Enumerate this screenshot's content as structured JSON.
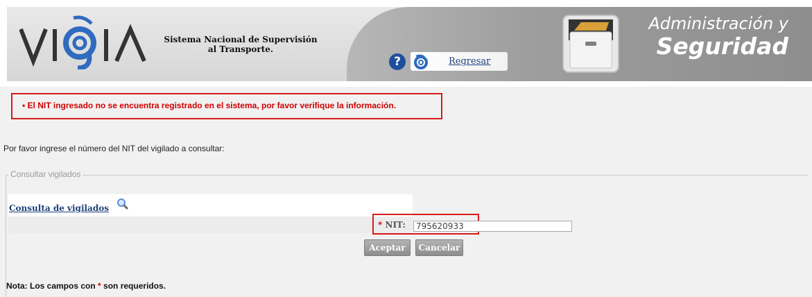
{
  "header": {
    "logo_text": "VIGIA",
    "tagline_line1": "Sistema Nacional de Supervisión",
    "tagline_line2": "al Transporte.",
    "help_symbol": "?",
    "back_link": "Regresar",
    "section_title_line1": "Administración y",
    "section_title_line2": "Seguridad",
    "icons": [
      "help-icon",
      "back-logo-icon",
      "file-cabinet-icon"
    ]
  },
  "error": {
    "bullet": "•",
    "message": "El NIT ingresado no se encuentra registrado en el sistema, por favor verifique la información."
  },
  "instruction": "Por favor ingrese el número del NIT del vigilado a consultar:",
  "fieldset": {
    "legend": "Consultar vigilados",
    "consulta_link": "Consulta de vigilados",
    "nit_required_marker": "*",
    "nit_label": "NIT:",
    "nit_value": "795620933"
  },
  "buttons": {
    "accept": "Aceptar",
    "cancel": "Cancelar"
  },
  "note": {
    "prefix": "Nota: Los campos con",
    "marker": "*",
    "suffix": "son requeridos."
  },
  "colors": {
    "error_red": "#d10000",
    "highlight_border": "#d71a1a",
    "link_blue": "#1d3f7a",
    "header_gray": "#9d9d9d",
    "logo_blue": "#2f6bbf"
  }
}
